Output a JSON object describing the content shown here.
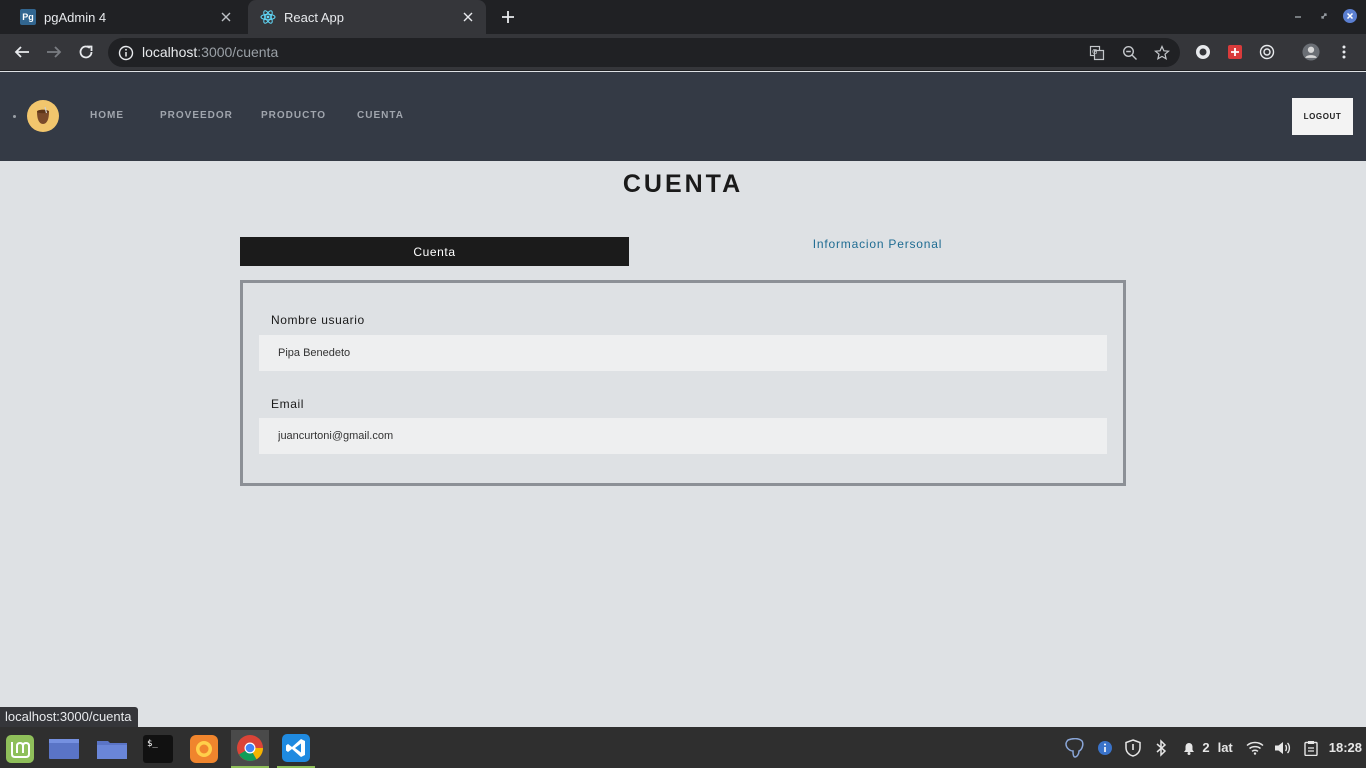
{
  "browser": {
    "tabs": [
      {
        "title": "pgAdmin 4",
        "favicon": "pgadmin-icon",
        "active": false
      },
      {
        "title": "React App",
        "favicon": "react-icon",
        "active": true
      }
    ],
    "url": {
      "host": "localhost",
      "path": ":3000/cuenta"
    },
    "status_link": "localhost:3000/cuenta"
  },
  "app": {
    "nav": {
      "links": [
        "HOME",
        "PROVEEDOR",
        "PRODUCTO",
        "CUENTA"
      ],
      "logout_label": "LOGOUT"
    },
    "page_title": "CUENTA",
    "tabs": {
      "cuenta": "Cuenta",
      "info": "Informacion Personal"
    },
    "form": {
      "username_label": "Nombre usuario",
      "username_value": "Pipa Benedeto",
      "email_label": "Email",
      "email_value": "juancurtoni@gmail.com"
    }
  },
  "taskbar": {
    "tray": {
      "notification_count": "2",
      "keyboard_layout": "lat",
      "clock": "18:28"
    }
  },
  "colors": {
    "nav_bg": "#343a45",
    "page_bg": "#dee1e4",
    "active_tab_bg": "#1b1b1b",
    "link_color": "#1f6c92"
  }
}
